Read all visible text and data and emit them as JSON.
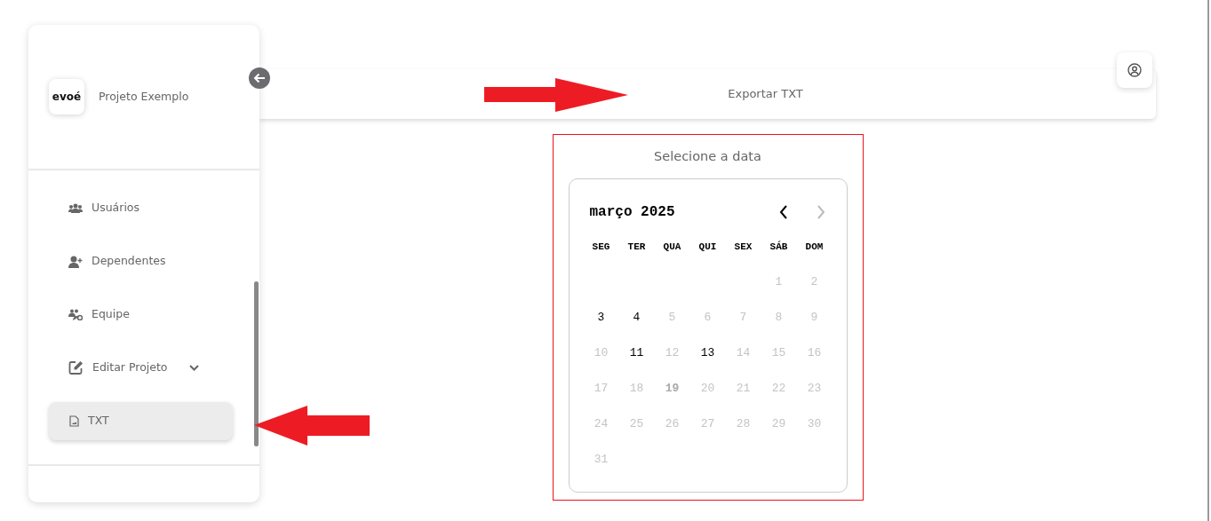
{
  "sidebar": {
    "logo": "evoé",
    "project_name": "Projeto Exemplo",
    "items": [
      {
        "label": "Usuários",
        "kind": "link",
        "selected": false
      },
      {
        "label": "Dependentes",
        "kind": "link",
        "selected": false
      },
      {
        "label": "Equipe",
        "kind": "link",
        "selected": false
      },
      {
        "label": "Editar Projeto",
        "kind": "group",
        "expanded": false,
        "selected": false
      },
      {
        "label": "TXT",
        "kind": "link",
        "selected": true
      }
    ]
  },
  "header": {
    "title": "Exportar TXT"
  },
  "date_picker": {
    "heading": "Selecione a data",
    "month": "março 2025",
    "prev_disabled": false,
    "next_disabled": true,
    "weekdays": [
      "SEG",
      "TER",
      "QUA",
      "QUI",
      "SEX",
      "SÁB",
      "DOM"
    ],
    "weeks": [
      [
        {
          "kind": "blank"
        },
        {
          "kind": "blank"
        },
        {
          "kind": "blank"
        },
        {
          "kind": "blank"
        },
        {
          "kind": "blank"
        },
        {
          "kind": "day",
          "label": "1",
          "disabled": true
        },
        {
          "kind": "day",
          "label": "2",
          "disabled": true
        }
      ],
      [
        {
          "kind": "day",
          "label": "3",
          "disabled": false
        },
        {
          "kind": "day",
          "label": "4",
          "disabled": false
        },
        {
          "kind": "day",
          "label": "5",
          "disabled": true
        },
        {
          "kind": "day",
          "label": "6",
          "disabled": true
        },
        {
          "kind": "day",
          "label": "7",
          "disabled": true
        },
        {
          "kind": "day",
          "label": "8",
          "disabled": true
        },
        {
          "kind": "day",
          "label": "9",
          "disabled": true
        }
      ],
      [
        {
          "kind": "day",
          "label": "10",
          "disabled": true
        },
        {
          "kind": "day",
          "label": "11",
          "disabled": false
        },
        {
          "kind": "day",
          "label": "12",
          "disabled": true
        },
        {
          "kind": "day",
          "label": "13",
          "disabled": false
        },
        {
          "kind": "day",
          "label": "14",
          "disabled": true
        },
        {
          "kind": "day",
          "label": "15",
          "disabled": true
        },
        {
          "kind": "day",
          "label": "16",
          "disabled": true
        }
      ],
      [
        {
          "kind": "day",
          "label": "17",
          "disabled": true
        },
        {
          "kind": "day",
          "label": "18",
          "disabled": true
        },
        {
          "kind": "day",
          "label": "19",
          "disabled": true,
          "today": true
        },
        {
          "kind": "day",
          "label": "20",
          "disabled": true
        },
        {
          "kind": "day",
          "label": "21",
          "disabled": true
        },
        {
          "kind": "day",
          "label": "22",
          "disabled": true
        },
        {
          "kind": "day",
          "label": "23",
          "disabled": true
        }
      ],
      [
        {
          "kind": "day",
          "label": "24",
          "disabled": true
        },
        {
          "kind": "day",
          "label": "25",
          "disabled": true
        },
        {
          "kind": "day",
          "label": "26",
          "disabled": true
        },
        {
          "kind": "day",
          "label": "27",
          "disabled": true
        },
        {
          "kind": "day",
          "label": "28",
          "disabled": true
        },
        {
          "kind": "day",
          "label": "29",
          "disabled": true
        },
        {
          "kind": "day",
          "label": "30",
          "disabled": true
        }
      ],
      [
        {
          "kind": "day",
          "label": "31",
          "disabled": true
        },
        {
          "kind": "blank"
        },
        {
          "kind": "blank"
        },
        {
          "kind": "blank"
        },
        {
          "kind": "blank"
        },
        {
          "kind": "blank"
        },
        {
          "kind": "blank"
        }
      ]
    ]
  }
}
